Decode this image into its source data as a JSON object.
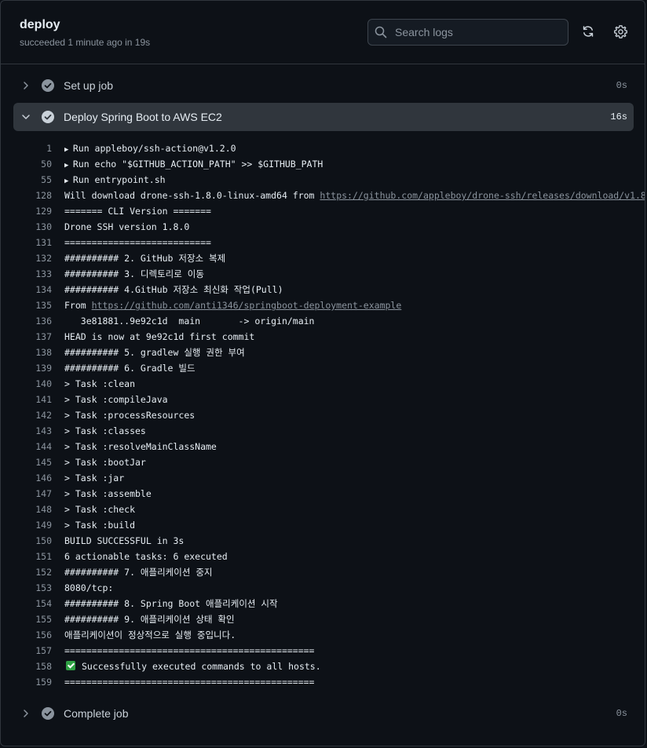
{
  "job": {
    "title": "deploy",
    "subtitle": "succeeded 1 minute ago in 19s"
  },
  "search": {
    "placeholder": "Search logs"
  },
  "icons": {
    "search": "search-icon",
    "refresh": "sync-icon",
    "settings": "gear-icon",
    "step_status": "check-circle-icon"
  },
  "colors": {
    "success": "#2ea043",
    "muted": "#8b949e",
    "background": "#0d1117"
  },
  "steps": [
    {
      "label": "Set up job",
      "duration": "0s"
    },
    {
      "label": "Deploy Spring Boot to AWS EC2",
      "duration": "16s"
    },
    {
      "label": "Complete job",
      "duration": "0s"
    }
  ],
  "log_lines": [
    {
      "num": "1",
      "text": "Run appleboy/ssh-action@v1.2.0",
      "group": true
    },
    {
      "num": "50",
      "text": "Run echo \"$GITHUB_ACTION_PATH\" >> $GITHUB_PATH",
      "group": true
    },
    {
      "num": "55",
      "text": "Run entrypoint.sh",
      "group": true
    },
    {
      "num": "128",
      "text": "Will download drone-ssh-1.8.0-linux-amd64 from ",
      "link": "https://github.com/appleboy/drone-ssh/releases/download/v1.8.0"
    },
    {
      "num": "129",
      "text": "======= CLI Version ======="
    },
    {
      "num": "130",
      "text": "Drone SSH version 1.8.0"
    },
    {
      "num": "131",
      "text": "==========================="
    },
    {
      "num": "132",
      "text": "########## 2. GitHub 저장소 복제"
    },
    {
      "num": "133",
      "text": "########## 3. 디렉토리로 이동"
    },
    {
      "num": "134",
      "text": "########## 4.GitHub 저장소 최신화 작업(Pull)"
    },
    {
      "num": "135",
      "text": "From ",
      "link": "https://github.com/anti1346/springboot-deployment-example"
    },
    {
      "num": "136",
      "text": "   3e81881..9e92c1d  main       -> origin/main"
    },
    {
      "num": "137",
      "text": "HEAD is now at 9e92c1d first commit"
    },
    {
      "num": "138",
      "text": "########## 5. gradlew 실행 권한 부여"
    },
    {
      "num": "139",
      "text": "########## 6. Gradle 빌드"
    },
    {
      "num": "140",
      "text": "> Task :clean"
    },
    {
      "num": "141",
      "text": "> Task :compileJava"
    },
    {
      "num": "142",
      "text": "> Task :processResources"
    },
    {
      "num": "143",
      "text": "> Task :classes"
    },
    {
      "num": "144",
      "text": "> Task :resolveMainClassName"
    },
    {
      "num": "145",
      "text": "> Task :bootJar"
    },
    {
      "num": "146",
      "text": "> Task :jar"
    },
    {
      "num": "147",
      "text": "> Task :assemble"
    },
    {
      "num": "148",
      "text": "> Task :check"
    },
    {
      "num": "149",
      "text": "> Task :build"
    },
    {
      "num": "150",
      "text": "BUILD SUCCESSFUL in 3s"
    },
    {
      "num": "151",
      "text": "6 actionable tasks: 6 executed"
    },
    {
      "num": "152",
      "text": "########## 7. 애플리케이션 중지"
    },
    {
      "num": "153",
      "text": "8080/tcp:"
    },
    {
      "num": "154",
      "text": "########## 8. Spring Boot 애플리케이션 시작"
    },
    {
      "num": "155",
      "text": "########## 9. 애플리케이션 상태 확인"
    },
    {
      "num": "156",
      "text": "애플리케이션이 정상적으로 실행 중입니다."
    },
    {
      "num": "157",
      "text": "=============================================="
    },
    {
      "num": "158",
      "text": "Successfully executed commands to all hosts.",
      "ok": true
    },
    {
      "num": "159",
      "text": "=============================================="
    }
  ]
}
